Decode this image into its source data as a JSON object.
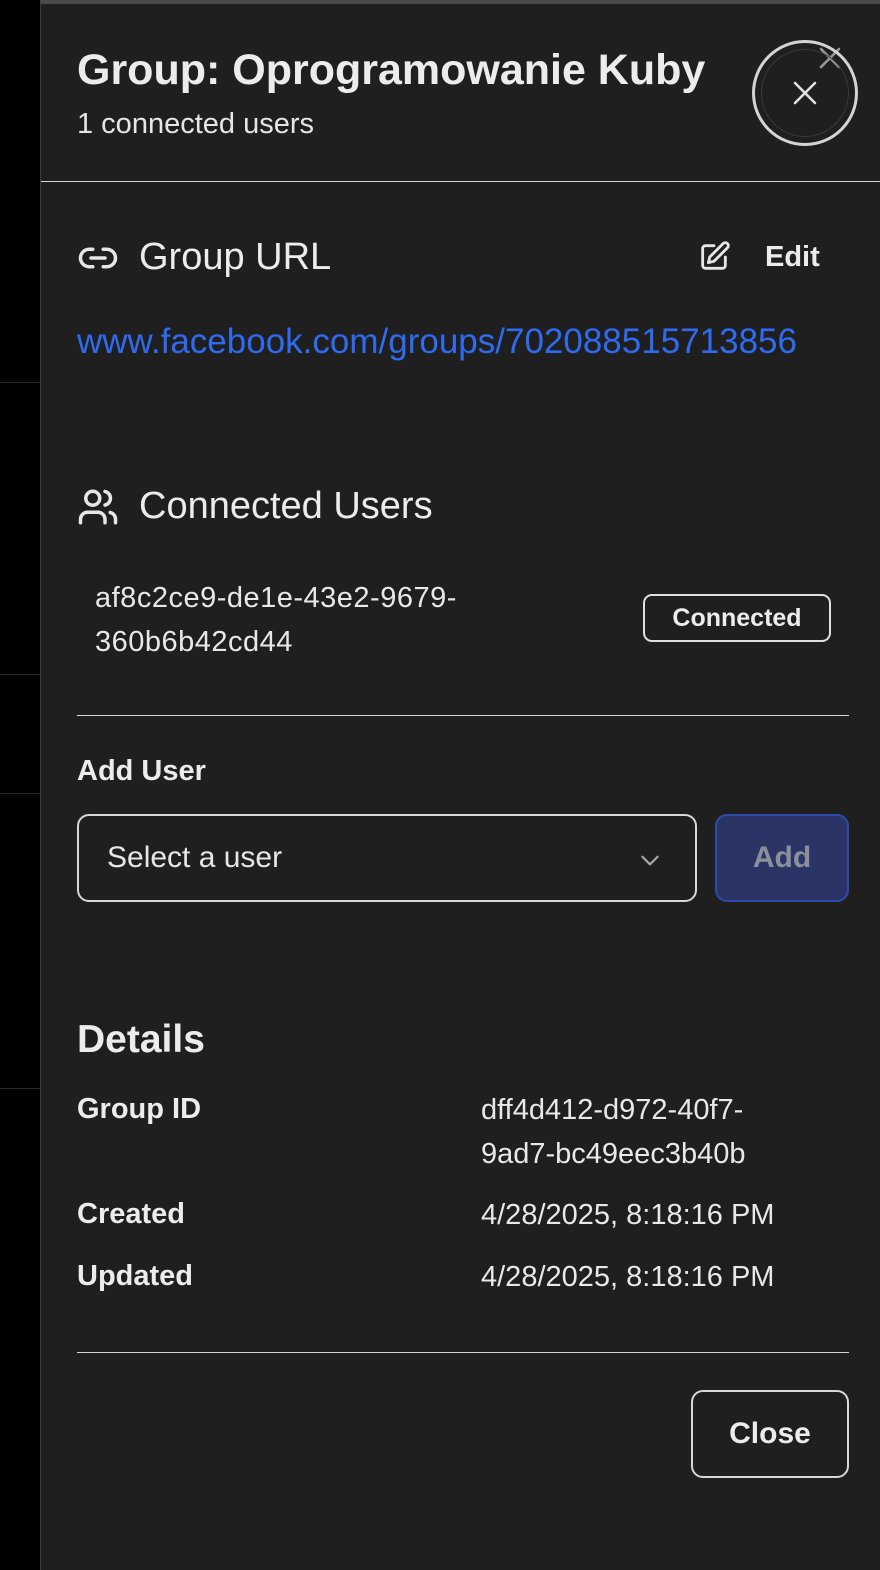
{
  "header": {
    "title": "Group: Oprogramowanie Kuby",
    "subtitle": "1 connected users"
  },
  "group_url": {
    "heading": "Group URL",
    "edit_label": "Edit",
    "url": "www.facebook.com/groups/702088515713856"
  },
  "connected_users": {
    "heading": "Connected Users",
    "users": [
      {
        "id_line1": "af8c2ce9-de1e-43e2-9679-",
        "id_line2": "360b6b42cd44",
        "status": "Connected"
      }
    ]
  },
  "add_user": {
    "label": "Add User",
    "select_placeholder": "Select a user",
    "add_label": "Add"
  },
  "details": {
    "title": "Details",
    "group_id_label": "Group ID",
    "group_id_line1": "dff4d412-d972-40f7-",
    "group_id_line2": "9ad7-bc49eec3b40b",
    "created_label": "Created",
    "created_value": "4/28/2025, 8:18:16 PM",
    "updated_label": "Updated",
    "updated_value": "4/28/2025, 8:18:16 PM"
  },
  "footer": {
    "close_label": "Close"
  },
  "colors": {
    "panel_bg": "#1f1f1f",
    "link": "#2f6bf0",
    "add_button_bg": "#2a3566",
    "add_button_border": "#2f4aa8"
  }
}
